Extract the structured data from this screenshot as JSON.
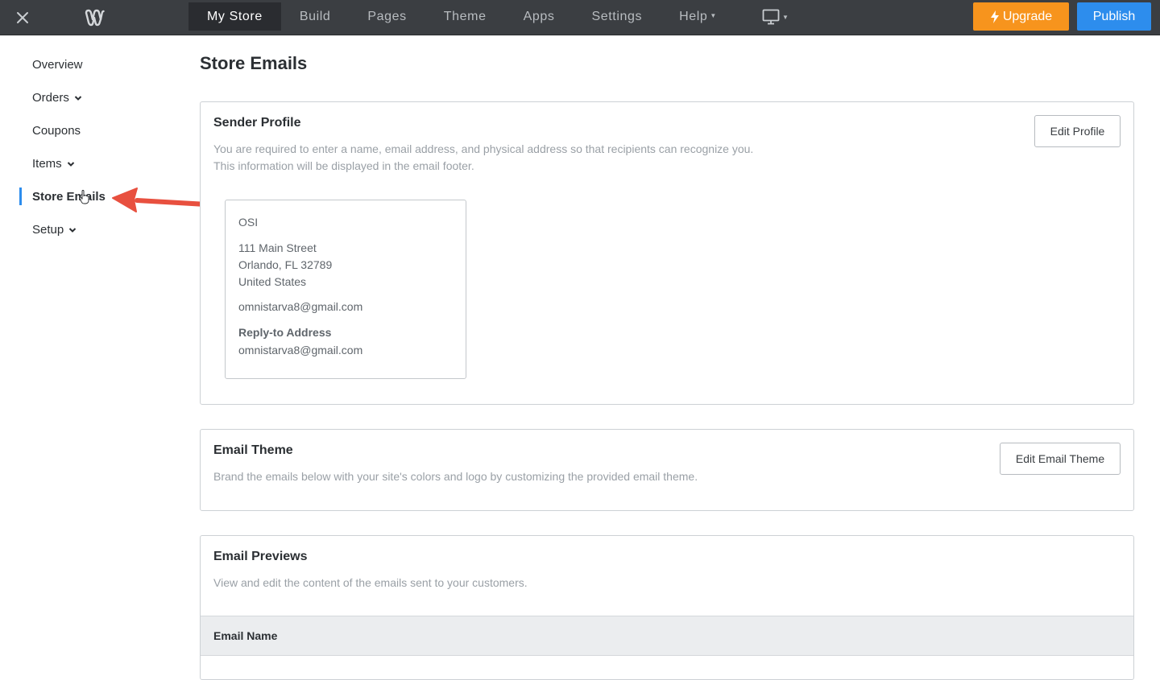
{
  "topbar": {
    "nav": [
      {
        "label": "My Store",
        "active": true
      },
      {
        "label": "Build"
      },
      {
        "label": "Pages"
      },
      {
        "label": "Theme"
      },
      {
        "label": "Apps"
      },
      {
        "label": "Settings"
      },
      {
        "label": "Help",
        "caret": true
      }
    ],
    "upgrade_label": "Upgrade",
    "publish_label": "Publish",
    "colors": {
      "bar": "#3b3e42",
      "upgrade": "#f7941d",
      "publish": "#2d8ded"
    }
  },
  "sidebar": {
    "items": [
      {
        "label": "Overview"
      },
      {
        "label": "Orders",
        "chevron": true
      },
      {
        "label": "Coupons"
      },
      {
        "label": "Items",
        "chevron": true
      },
      {
        "label": "Store Emails",
        "active": true
      },
      {
        "label": "Setup",
        "chevron": true
      }
    ]
  },
  "main": {
    "title": "Store Emails",
    "sender_profile": {
      "title": "Sender Profile",
      "desc_line1": "You are required to enter a name, email address, and physical address so that recipients can recognize you.",
      "desc_line2": "This information will be displayed in the email footer.",
      "edit_label": "Edit Profile",
      "name": "OSI",
      "street": "111 Main Street",
      "city": "Orlando, FL 32789",
      "country": "United States",
      "email": "omnistarva8@gmail.com",
      "reply_to_label": "Reply-to Address",
      "reply_to_email": "omnistarva8@gmail.com"
    },
    "email_theme": {
      "title": "Email Theme",
      "desc": "Brand the emails below with your site's colors and logo by customizing the provided email theme.",
      "edit_label": "Edit Email Theme"
    },
    "email_previews": {
      "title": "Email Previews",
      "desc": "View and edit the content of the emails sent to your customers.",
      "column_header": "Email Name"
    }
  }
}
